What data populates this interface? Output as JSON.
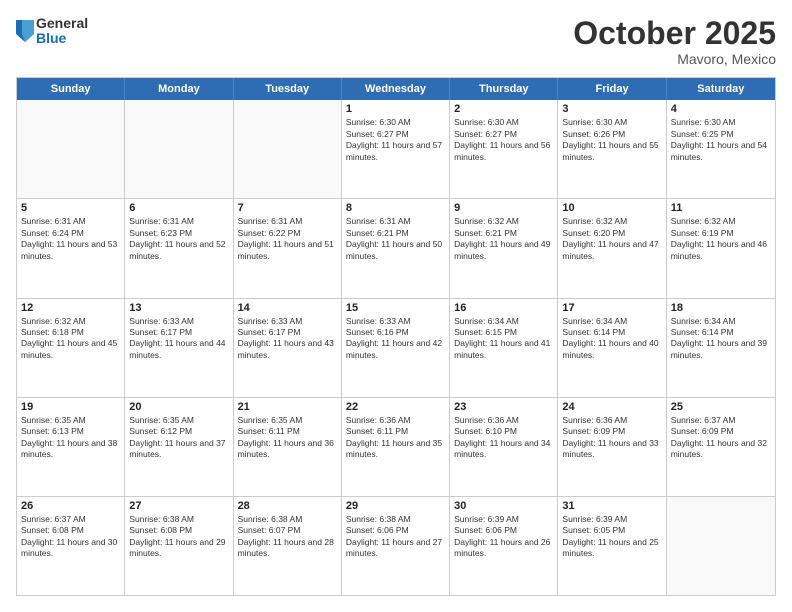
{
  "header": {
    "logo": {
      "general": "General",
      "blue": "Blue"
    },
    "title": "October 2025",
    "location": "Mavoro, Mexico"
  },
  "calendar": {
    "days_of_week": [
      "Sunday",
      "Monday",
      "Tuesday",
      "Wednesday",
      "Thursday",
      "Friday",
      "Saturday"
    ],
    "weeks": [
      [
        {
          "day": "",
          "empty": true
        },
        {
          "day": "",
          "empty": true
        },
        {
          "day": "",
          "empty": true
        },
        {
          "day": "1",
          "sunrise": "6:30 AM",
          "sunset": "6:27 PM",
          "daylight": "11 hours and 57 minutes."
        },
        {
          "day": "2",
          "sunrise": "6:30 AM",
          "sunset": "6:27 PM",
          "daylight": "11 hours and 56 minutes."
        },
        {
          "day": "3",
          "sunrise": "6:30 AM",
          "sunset": "6:26 PM",
          "daylight": "11 hours and 55 minutes."
        },
        {
          "day": "4",
          "sunrise": "6:30 AM",
          "sunset": "6:25 PM",
          "daylight": "11 hours and 54 minutes."
        }
      ],
      [
        {
          "day": "5",
          "sunrise": "6:31 AM",
          "sunset": "6:24 PM",
          "daylight": "11 hours and 53 minutes."
        },
        {
          "day": "6",
          "sunrise": "6:31 AM",
          "sunset": "6:23 PM",
          "daylight": "11 hours and 52 minutes."
        },
        {
          "day": "7",
          "sunrise": "6:31 AM",
          "sunset": "6:22 PM",
          "daylight": "11 hours and 51 minutes."
        },
        {
          "day": "8",
          "sunrise": "6:31 AM",
          "sunset": "6:21 PM",
          "daylight": "11 hours and 50 minutes."
        },
        {
          "day": "9",
          "sunrise": "6:32 AM",
          "sunset": "6:21 PM",
          "daylight": "11 hours and 49 minutes."
        },
        {
          "day": "10",
          "sunrise": "6:32 AM",
          "sunset": "6:20 PM",
          "daylight": "11 hours and 47 minutes."
        },
        {
          "day": "11",
          "sunrise": "6:32 AM",
          "sunset": "6:19 PM",
          "daylight": "11 hours and 46 minutes."
        }
      ],
      [
        {
          "day": "12",
          "sunrise": "6:32 AM",
          "sunset": "6:18 PM",
          "daylight": "11 hours and 45 minutes."
        },
        {
          "day": "13",
          "sunrise": "6:33 AM",
          "sunset": "6:17 PM",
          "daylight": "11 hours and 44 minutes."
        },
        {
          "day": "14",
          "sunrise": "6:33 AM",
          "sunset": "6:17 PM",
          "daylight": "11 hours and 43 minutes."
        },
        {
          "day": "15",
          "sunrise": "6:33 AM",
          "sunset": "6:16 PM",
          "daylight": "11 hours and 42 minutes."
        },
        {
          "day": "16",
          "sunrise": "6:34 AM",
          "sunset": "6:15 PM",
          "daylight": "11 hours and 41 minutes."
        },
        {
          "day": "17",
          "sunrise": "6:34 AM",
          "sunset": "6:14 PM",
          "daylight": "11 hours and 40 minutes."
        },
        {
          "day": "18",
          "sunrise": "6:34 AM",
          "sunset": "6:14 PM",
          "daylight": "11 hours and 39 minutes."
        }
      ],
      [
        {
          "day": "19",
          "sunrise": "6:35 AM",
          "sunset": "6:13 PM",
          "daylight": "11 hours and 38 minutes."
        },
        {
          "day": "20",
          "sunrise": "6:35 AM",
          "sunset": "6:12 PM",
          "daylight": "11 hours and 37 minutes."
        },
        {
          "day": "21",
          "sunrise": "6:35 AM",
          "sunset": "6:11 PM",
          "daylight": "11 hours and 36 minutes."
        },
        {
          "day": "22",
          "sunrise": "6:36 AM",
          "sunset": "6:11 PM",
          "daylight": "11 hours and 35 minutes."
        },
        {
          "day": "23",
          "sunrise": "6:36 AM",
          "sunset": "6:10 PM",
          "daylight": "11 hours and 34 minutes."
        },
        {
          "day": "24",
          "sunrise": "6:36 AM",
          "sunset": "6:09 PM",
          "daylight": "11 hours and 33 minutes."
        },
        {
          "day": "25",
          "sunrise": "6:37 AM",
          "sunset": "6:09 PM",
          "daylight": "11 hours and 32 minutes."
        }
      ],
      [
        {
          "day": "26",
          "sunrise": "6:37 AM",
          "sunset": "6:08 PM",
          "daylight": "11 hours and 30 minutes."
        },
        {
          "day": "27",
          "sunrise": "6:38 AM",
          "sunset": "6:08 PM",
          "daylight": "11 hours and 29 minutes."
        },
        {
          "day": "28",
          "sunrise": "6:38 AM",
          "sunset": "6:07 PM",
          "daylight": "11 hours and 28 minutes."
        },
        {
          "day": "29",
          "sunrise": "6:38 AM",
          "sunset": "6:06 PM",
          "daylight": "11 hours and 27 minutes."
        },
        {
          "day": "30",
          "sunrise": "6:39 AM",
          "sunset": "6:06 PM",
          "daylight": "11 hours and 26 minutes."
        },
        {
          "day": "31",
          "sunrise": "6:39 AM",
          "sunset": "6:05 PM",
          "daylight": "11 hours and 25 minutes."
        },
        {
          "day": "",
          "empty": true
        }
      ]
    ]
  }
}
